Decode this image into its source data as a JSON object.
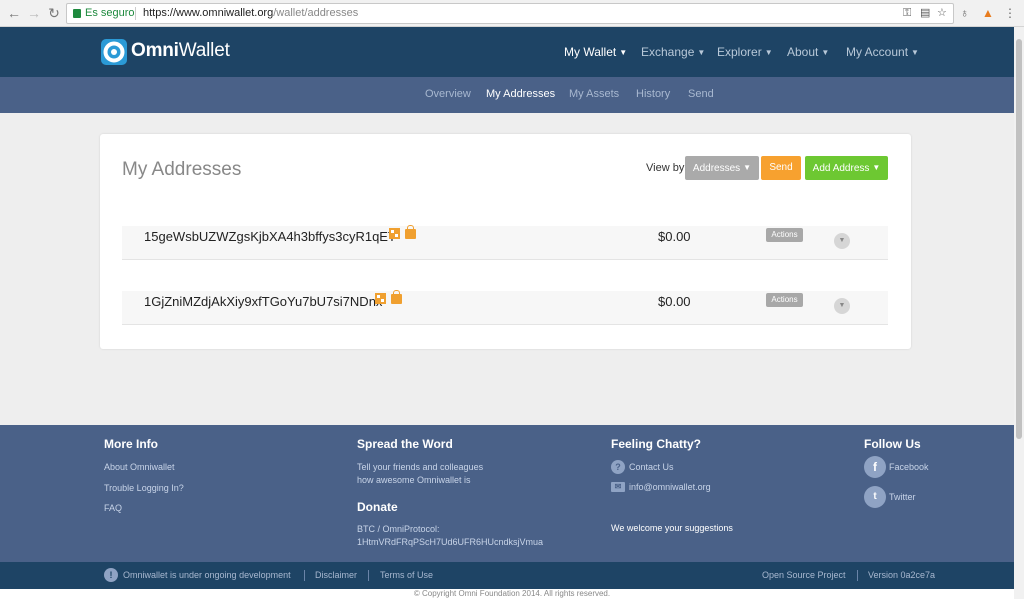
{
  "browser": {
    "secure_label": "Es seguro",
    "url_host": "https://www.omniwallet.org",
    "url_path": "/wallet/addresses"
  },
  "brand": {
    "name_bold": "Omni",
    "name_rest": "Wallet"
  },
  "nav": {
    "items": [
      {
        "label": "My Wallet",
        "active": true
      },
      {
        "label": "Exchange"
      },
      {
        "label": "Explorer"
      },
      {
        "label": "About"
      },
      {
        "label": "My Account"
      }
    ]
  },
  "subnav": {
    "items": [
      {
        "label": "Overview"
      },
      {
        "label": "My Addresses",
        "active": true
      },
      {
        "label": "My Assets"
      },
      {
        "label": "History"
      },
      {
        "label": "Send"
      }
    ]
  },
  "panel": {
    "title": "My Addresses",
    "view_by_label": "View by",
    "view_by_value": "Addresses",
    "send_label": "Send",
    "add_address_label": "Add Address",
    "rows": [
      {
        "address": "15geWsbUZWZgsKjbXA4h3bffys3cyR1qET",
        "balance": "$0.00",
        "actions_label": "Actions"
      },
      {
        "address": "1GjZniMZdjAkXiy9xfTGoYu7bU7si7NDnx",
        "balance": "$0.00",
        "actions_label": "Actions"
      }
    ]
  },
  "footer": {
    "more_info": {
      "heading": "More Info",
      "links": [
        "About Omniwallet",
        "Trouble Logging In?",
        "FAQ"
      ]
    },
    "spread": {
      "heading": "Spread the Word",
      "line1": "Tell your friends and colleagues",
      "line2": "how awesome Omniwallet is"
    },
    "donate": {
      "heading": "Donate",
      "label": "BTC / OmniProtocol:",
      "address": "1HtmVRdFRqPScH7Ud6UFR6HUcndksjVmua"
    },
    "chatty": {
      "heading": "Feeling Chatty?",
      "contact": "Contact Us",
      "email": "info@omniwallet.org",
      "suggestions": "We welcome your suggestions"
    },
    "follow": {
      "heading": "Follow Us",
      "facebook": "Facebook",
      "twitter": "Twitter"
    }
  },
  "bottombar": {
    "notice": "Omniwallet is under ongoing development",
    "disclaimer": "Disclaimer",
    "terms": "Terms of Use",
    "open_source": "Open Source Project",
    "version": "Version 0a2ce7a"
  },
  "copyright": "© Copyright Omni Foundation 2014. All rights reserved.",
  "colors": {
    "nav_bg": "#1e4465",
    "subnav_bg": "#4a6188",
    "orange": "#f7a12f",
    "green": "#6dc832"
  }
}
